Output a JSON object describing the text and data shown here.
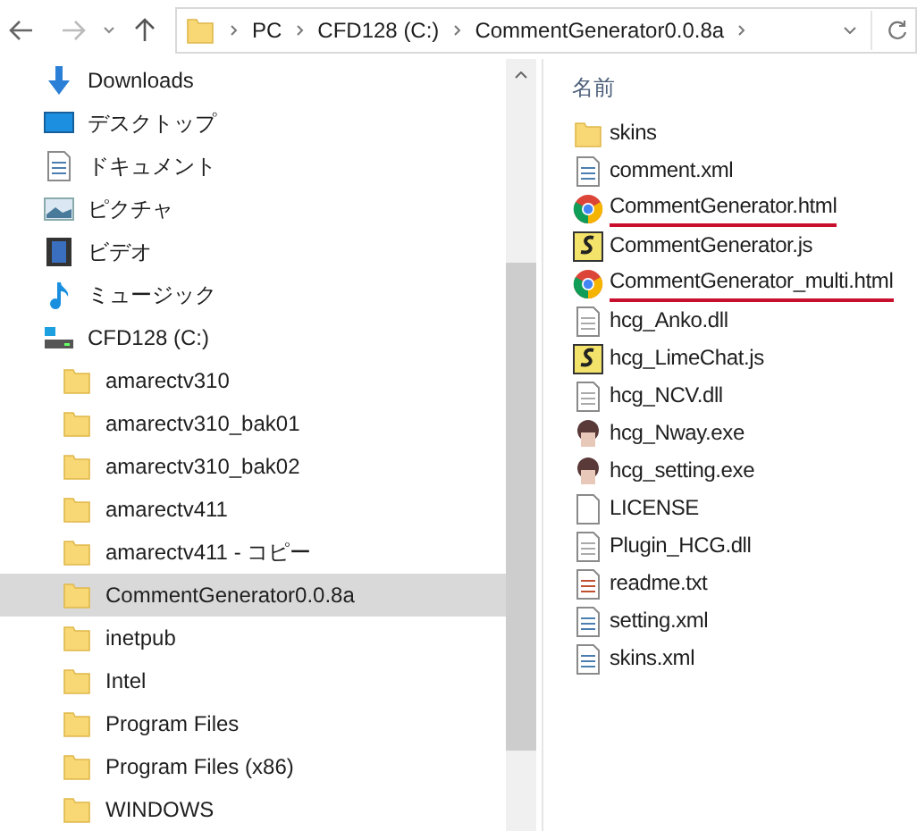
{
  "address_bar": {
    "breadcrumbs": [
      "PC",
      "CFD128 (C:)",
      "CommentGenerator0.0.8a"
    ]
  },
  "navigation": {
    "items": [
      {
        "kind": "downloads",
        "label": "Downloads",
        "selected": false
      },
      {
        "kind": "desktop",
        "label": "デスクトップ",
        "selected": false
      },
      {
        "kind": "documents",
        "label": "ドキュメント",
        "selected": false
      },
      {
        "kind": "pictures",
        "label": "ピクチャ",
        "selected": false
      },
      {
        "kind": "videos",
        "label": "ビデオ",
        "selected": false
      },
      {
        "kind": "music",
        "label": "ミュージック",
        "selected": false
      },
      {
        "kind": "drive",
        "label": "CFD128 (C:)",
        "selected": false,
        "children": [
          {
            "kind": "folder",
            "label": "amarectv310",
            "selected": false
          },
          {
            "kind": "folder",
            "label": "amarectv310_bak01",
            "selected": false
          },
          {
            "kind": "folder",
            "label": "amarectv310_bak02",
            "selected": false
          },
          {
            "kind": "folder",
            "label": "amarectv411",
            "selected": false
          },
          {
            "kind": "folder",
            "label": "amarectv411 - コピー",
            "selected": false
          },
          {
            "kind": "folder",
            "label": "CommentGenerator0.0.8a",
            "selected": true
          },
          {
            "kind": "folder",
            "label": "inetpub",
            "selected": false
          },
          {
            "kind": "folder",
            "label": "Intel",
            "selected": false
          },
          {
            "kind": "folder",
            "label": "Program Files",
            "selected": false
          },
          {
            "kind": "folder",
            "label": "Program Files (x86)",
            "selected": false
          },
          {
            "kind": "folder",
            "label": "WINDOWS",
            "selected": false
          }
        ]
      }
    ]
  },
  "file_list": {
    "column_header": "名前",
    "files": [
      {
        "kind": "folder",
        "name": "skins",
        "underlined": false
      },
      {
        "kind": "xml",
        "name": "comment.xml",
        "underlined": false
      },
      {
        "kind": "chrome",
        "name": "CommentGenerator.html",
        "underlined": true
      },
      {
        "kind": "script",
        "name": "CommentGenerator.js",
        "underlined": false
      },
      {
        "kind": "chrome",
        "name": "CommentGenerator_multi.html",
        "underlined": true
      },
      {
        "kind": "dll",
        "name": "hcg_Anko.dll",
        "underlined": false
      },
      {
        "kind": "script",
        "name": "hcg_LimeChat.js",
        "underlined": false
      },
      {
        "kind": "dll",
        "name": "hcg_NCV.dll",
        "underlined": false
      },
      {
        "kind": "exe",
        "name": "hcg_Nway.exe",
        "underlined": false
      },
      {
        "kind": "exe",
        "name": "hcg_setting.exe",
        "underlined": false
      },
      {
        "kind": "file",
        "name": "LICENSE",
        "underlined": false
      },
      {
        "kind": "dll",
        "name": "Plugin_HCG.dll",
        "underlined": false
      },
      {
        "kind": "txt",
        "name": "readme.txt",
        "underlined": false
      },
      {
        "kind": "xml",
        "name": "setting.xml",
        "underlined": false
      },
      {
        "kind": "xml",
        "name": "skins.xml",
        "underlined": false
      }
    ]
  }
}
